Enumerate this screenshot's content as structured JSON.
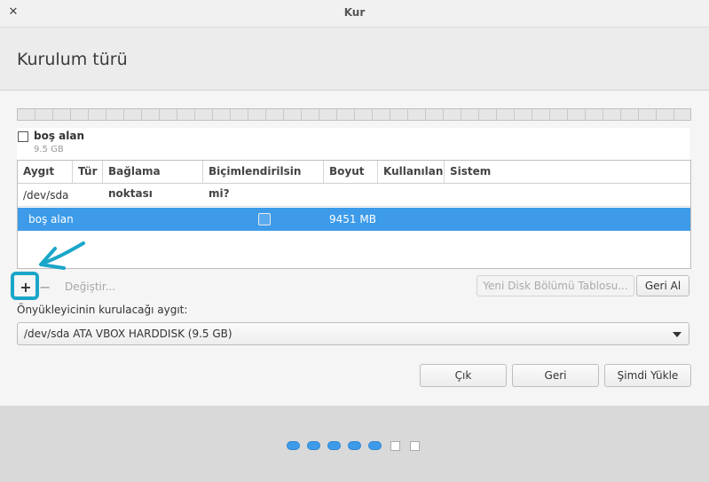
{
  "window": {
    "title": "Kur",
    "close_glyph": "✕"
  },
  "page_title": "Kurulum türü",
  "free_space": {
    "label": "boş alan",
    "size": "9.5 GB"
  },
  "table": {
    "columns": [
      "Aygıt",
      "Tür",
      "Bağlama noktası",
      "Biçimlendirilsin mi?",
      "Boyut",
      "Kullanılan",
      "Sistem"
    ],
    "device_row": {
      "device": "/dev/sda"
    },
    "selected_row": {
      "device": "boş alan",
      "size": "9451 MB",
      "format_checked": false
    }
  },
  "partition_toolbar": {
    "add_glyph": "+",
    "remove_glyph": "−",
    "change_label": "Değiştir...",
    "new_table_label": "Yeni Disk Bölümü Tablosu...",
    "revert_label": "Geri Al"
  },
  "bootloader": {
    "label": "Önyükleyicinin kurulacağı aygıt:",
    "selected": "/dev/sda ATA VBOX HARDDISK (9.5 GB)"
  },
  "actions": {
    "quit_label": "Çık",
    "back_label": "Geri",
    "install_label": "Şimdi Yükle"
  },
  "progress_steps": {
    "done": 5,
    "total": 7
  },
  "colors": {
    "accent": "#3d9be9",
    "annotation": "#1aa6c9"
  }
}
